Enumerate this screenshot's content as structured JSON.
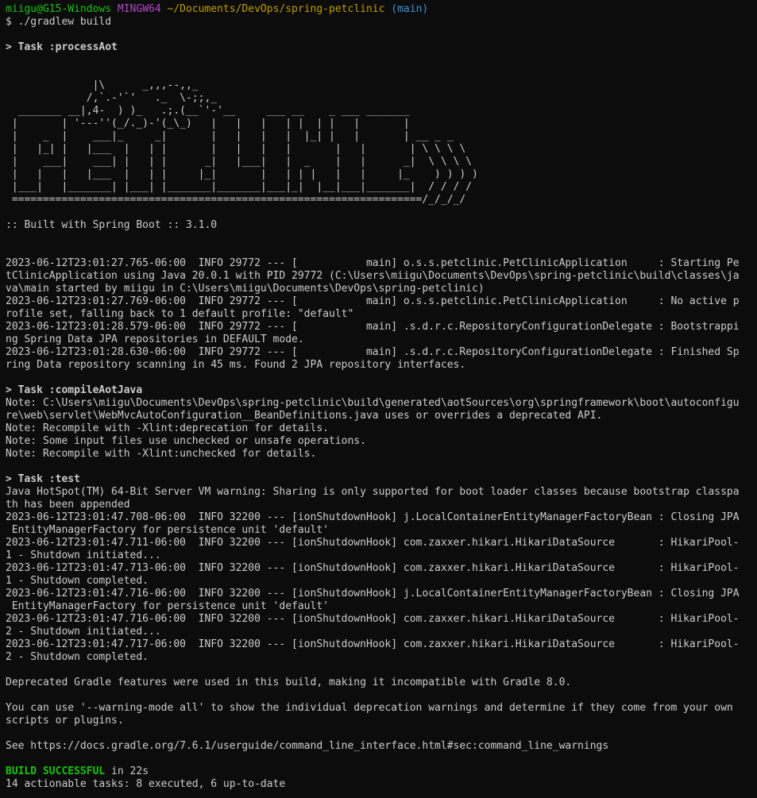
{
  "prompt": {
    "user_host": "miigu@G15-Windows",
    "shell": "MINGW64",
    "cwd": "~/Documents/DevOps/spring-petclinic",
    "branch": "(main)",
    "command": "$ ./gradlew build"
  },
  "task_process_aot": "> Task :processAot",
  "banner_lines": [
    "",
    "",
    "              |\\      _,,,--,,_",
    "             /,`.-'`'   ._  \\-;;,_",
    "  _______ __|,4-  ) )_   .;.(__`'-'__     ___ __    _ ___ _______",
    " |       | '---''(_/._)-'(_\\_)   |   |   |   | |  | |   |       |",
    " |    _  |    ___|_     _|       |   |   |   |  |_| |   |       | __ _ _",
    " |   |_| |   |___  |   | |       |   |   |   |       |   |       | \\ \\ \\ \\",
    " |    ___|    ___| |   | |      _|   |___|   |  _    |   |      _|  \\ \\ \\ \\",
    " |   |   |   |___  |   | |     |_|       |   | | |   |   |     |_    ) ) ) )",
    " |___|   |_______| |___| |_______|_______|___|_|  |__|___|_______|  / / / /",
    " ==================================================================/_/_/_/",
    ""
  ],
  "built_with": ":: Built with Spring Boot :: 3.1.0",
  "log_block_1": [
    "",
    "",
    "2023-06-12T23:01:27.765-06:00  INFO 29772 --- [           main] o.s.s.petclinic.PetClinicApplication     : Starting Pe",
    "tClinicApplication using Java 20.0.1 with PID 29772 (C:\\Users\\miigu\\Documents\\DevOps\\spring-petclinic\\build\\classes\\ja",
    "va\\main started by miigu in C:\\Users\\miigu\\Documents\\DevOps\\spring-petclinic)",
    "2023-06-12T23:01:27.769-06:00  INFO 29772 --- [           main] o.s.s.petclinic.PetClinicApplication     : No active p",
    "rofile set, falling back to 1 default profile: \"default\"",
    "2023-06-12T23:01:28.579-06:00  INFO 29772 --- [           main] .s.d.r.c.RepositoryConfigurationDelegate : Bootstrappi",
    "ng Spring Data JPA repositories in DEFAULT mode.",
    "2023-06-12T23:01:28.630-06:00  INFO 29772 --- [           main] .s.d.r.c.RepositoryConfigurationDelegate : Finished Sp",
    "ring Data repository scanning in 45 ms. Found 2 JPA repository interfaces.",
    ""
  ],
  "task_compile_aot_java": "> Task :compileAotJava",
  "log_block_2": [
    "Note: C:\\Users\\miigu\\Documents\\DevOps\\spring-petclinic\\build\\generated\\aotSources\\org\\springframework\\boot\\autoconfigu",
    "re\\web\\servlet\\WebMvcAutoConfiguration__BeanDefinitions.java uses or overrides a deprecated API.",
    "Note: Recompile with -Xlint:deprecation for details.",
    "Note: Some input files use unchecked or unsafe operations.",
    "Note: Recompile with -Xlint:unchecked for details.",
    ""
  ],
  "task_test": "> Task :test",
  "log_block_3": [
    "Java HotSpot(TM) 64-Bit Server VM warning: Sharing is only supported for boot loader classes because bootstrap classpa",
    "th has been appended",
    "2023-06-12T23:01:47.708-06:00  INFO 32200 --- [ionShutdownHook] j.LocalContainerEntityManagerFactoryBean : Closing JPA",
    " EntityManagerFactory for persistence unit 'default'",
    "2023-06-12T23:01:47.711-06:00  INFO 32200 --- [ionShutdownHook] com.zaxxer.hikari.HikariDataSource       : HikariPool-",
    "1 - Shutdown initiated...",
    "2023-06-12T23:01:47.713-06:00  INFO 32200 --- [ionShutdownHook] com.zaxxer.hikari.HikariDataSource       : HikariPool-",
    "1 - Shutdown completed.",
    "2023-06-12T23:01:47.716-06:00  INFO 32200 --- [ionShutdownHook] j.LocalContainerEntityManagerFactoryBean : Closing JPA",
    " EntityManagerFactory for persistence unit 'default'",
    "2023-06-12T23:01:47.716-06:00  INFO 32200 --- [ionShutdownHook] com.zaxxer.hikari.HikariDataSource       : HikariPool-",
    "2 - Shutdown initiated...",
    "2023-06-12T23:01:47.717-06:00  INFO 32200 --- [ionShutdownHook] com.zaxxer.hikari.HikariDataSource       : HikariPool-",
    "2 - Shutdown completed.",
    "",
    "Deprecated Gradle features were used in this build, making it incompatible with Gradle 8.0.",
    "",
    "You can use '--warning-mode all' to show the individual deprecation warnings and determine if they come from your own",
    "scripts or plugins.",
    "",
    "See https://docs.gradle.org/7.6.1/userguide/command_line_interface.html#sec:command_line_warnings",
    ""
  ],
  "build_status": "BUILD SUCCESSFUL",
  "build_time": " in 22s",
  "summary": "14 actionable tasks: 8 executed, 6 up-to-date",
  "colors": {
    "background": "#0c0c0c",
    "foreground": "#cccccc",
    "user_host": "#16c60c",
    "shell": "#b148c6",
    "path": "#c19c00",
    "branch": "#3a96dd",
    "success": "#16c60c"
  }
}
